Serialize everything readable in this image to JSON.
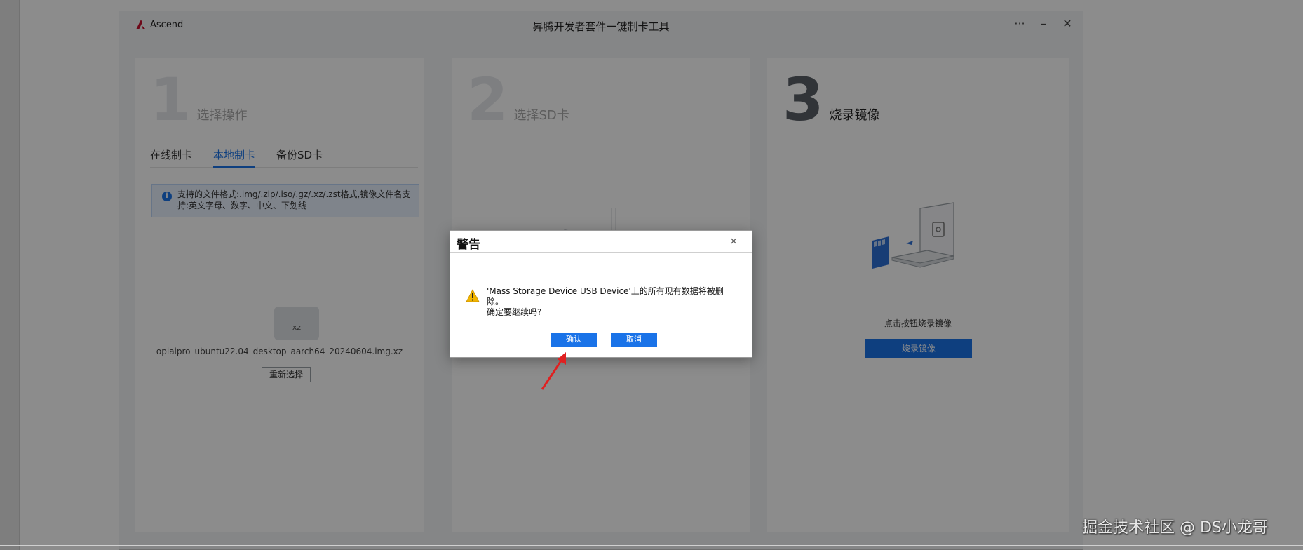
{
  "app": {
    "logo_text": "Ascend",
    "title": "昇腾开发者套件一键制卡工具",
    "window_controls": {
      "more": "···",
      "minimize": "–",
      "close": "✕"
    }
  },
  "step1": {
    "number": "1",
    "label": "选择操作",
    "tabs": [
      {
        "label": "在线制卡",
        "active": false
      },
      {
        "label": "本地制卡",
        "active": true
      },
      {
        "label": "备份SD卡",
        "active": false
      }
    ],
    "info_text": "支持的文件格式:.img/.zip/.iso/.gz/.xz/.zst格式,镜像文件名支持:英文字母、数字、中文、下划线",
    "file_ext": "xz",
    "file_name": "opiaipro_ubuntu22.04_desktop_aarch64_20240604.img.xz",
    "reselect_button": "重新选择"
  },
  "step2": {
    "number": "2",
    "label": "选择SD卡"
  },
  "step3": {
    "number": "3",
    "label": "烧录镜像",
    "hint": "点击按钮烧录镜像",
    "burn_button": "烧录镜像"
  },
  "dialog": {
    "title": "警告",
    "close": "×",
    "message_line1": "'Mass Storage Device USB Device'上的所有现有数据将被删除。",
    "message_line2": "确定要继续吗?",
    "confirm_button": "确认",
    "cancel_button": "取消"
  },
  "watermark": "掘金技术社区 @ DS小龙哥",
  "colors": {
    "accent": "#1a73e8",
    "warning": "#f0b400",
    "arrow": "#e02020"
  }
}
